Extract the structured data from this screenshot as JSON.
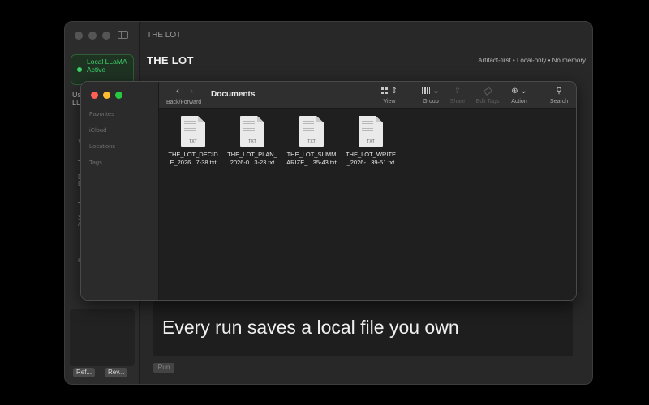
{
  "app": {
    "window_title": "THE LOT",
    "heading": "THE LOT",
    "tagline": "Artifact-first • Local-only • No memory",
    "status": {
      "text": "Local LLaMA Active",
      "color": "#3ed16a"
    },
    "sidebar_fragments": [
      "Us",
      "LL",
      "T",
      "V",
      "T",
      "D",
      "E",
      "T",
      "S",
      "A",
      "T",
      "F"
    ],
    "sidebar_buttons": [
      "Ref...",
      "Rev..."
    ],
    "run_button": "Run",
    "caption": "Every run saves a local file you own"
  },
  "finder": {
    "title": "Documents",
    "nav_label": "Back/Forward",
    "sidebar": [
      "Favorites",
      "iCloud",
      "Locations",
      "Tags"
    ],
    "toolbar": [
      {
        "icon": "grid-icon",
        "label": "View",
        "enabled": true
      },
      {
        "icon": "group-icon",
        "label": "Group",
        "enabled": true
      },
      {
        "icon": "share-icon",
        "label": "Share",
        "enabled": false
      },
      {
        "icon": "tag-icon",
        "label": "Edit Tags",
        "enabled": false
      },
      {
        "icon": "ellipsis-circle-icon",
        "label": "Action",
        "enabled": true
      },
      {
        "icon": "search-icon",
        "label": "Search",
        "enabled": true
      }
    ],
    "files": [
      {
        "name": "THE_LOT_DECID\nE_2026...7-38.txt",
        "ext": "TXT"
      },
      {
        "name": "THE_LOT_PLAN_\n2026-0...3-23.txt",
        "ext": "TXT"
      },
      {
        "name": "THE_LOT_SUMM\nARIZE_...35-43.txt",
        "ext": "TXT"
      },
      {
        "name": "THE_LOT_WRITE\n_2026-...39-51.txt",
        "ext": "TXT"
      }
    ]
  }
}
